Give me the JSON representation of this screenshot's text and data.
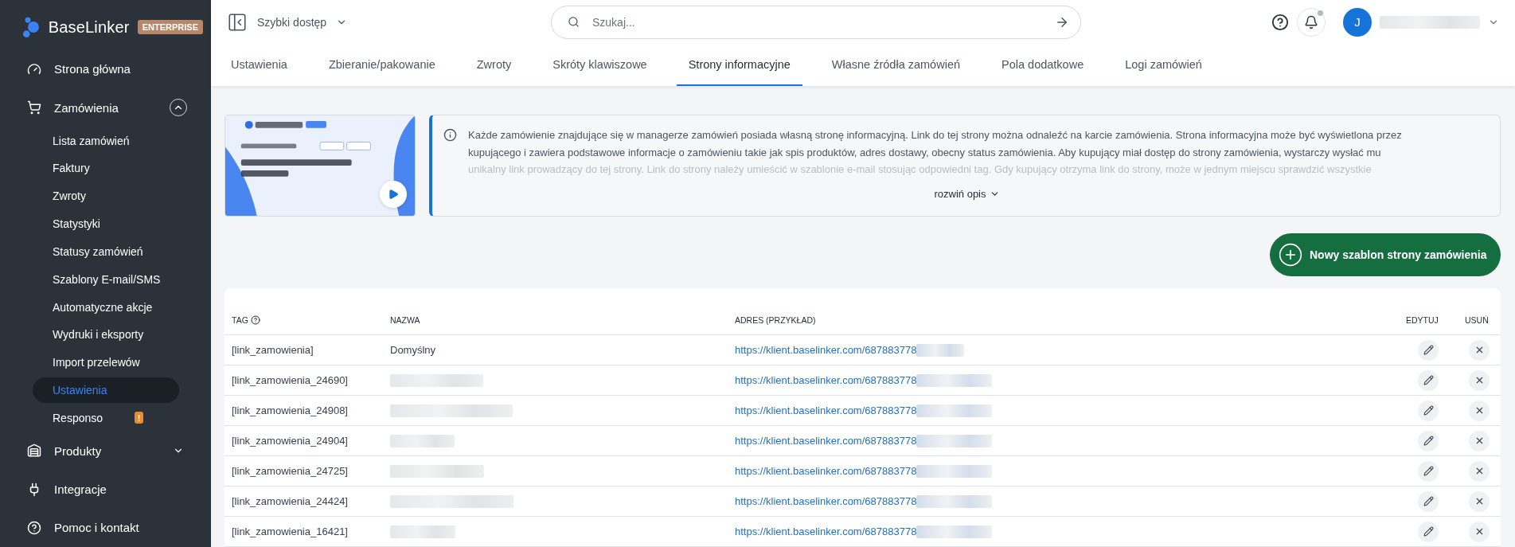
{
  "sidebar": {
    "logo": "BaseLinker",
    "plan_badge": "ENTERPRISE",
    "items": [
      {
        "label": "Strona główna"
      },
      {
        "label": "Zamówienia",
        "expanded": true,
        "children": [
          {
            "label": "Lista zamówień",
            "selected": false
          },
          {
            "label": "Faktury",
            "selected": false
          },
          {
            "label": "Zwroty",
            "selected": false
          },
          {
            "label": "Statystyki",
            "selected": false
          },
          {
            "label": "Statusy zamówień",
            "selected": false
          },
          {
            "label": "Szablony E-mail/SMS",
            "selected": false
          },
          {
            "label": "Automatyczne akcje",
            "selected": false
          },
          {
            "label": "Wydruki i eksporty",
            "selected": false
          },
          {
            "label": "Import przelewów",
            "selected": false
          },
          {
            "label": "Ustawienia",
            "selected": true
          },
          {
            "label": "Responso",
            "selected": false,
            "badge": "!"
          }
        ]
      },
      {
        "label": "Produkty",
        "expanded": false
      },
      {
        "label": "Integracje"
      },
      {
        "label": "Pomoc i kontakt"
      }
    ]
  },
  "topbar": {
    "quick_access": "Szybki dostęp",
    "search": {
      "placeholder": "Szukaj..."
    },
    "notifications": {
      "unread": true
    },
    "user": {
      "initial": "J"
    }
  },
  "tabs": [
    {
      "label": "Ustawienia",
      "selected": false
    },
    {
      "label": "Zbieranie/pakowanie",
      "selected": false
    },
    {
      "label": "Zwroty",
      "selected": false
    },
    {
      "label": "Skróty klawiszowe",
      "selected": false
    },
    {
      "label": "Strony informacyjne",
      "selected": true
    },
    {
      "label": "Własne źródła zamówień",
      "selected": false
    },
    {
      "label": "Pola dodatkowe",
      "selected": false
    },
    {
      "label": "Logi zamówień",
      "selected": false
    }
  ],
  "info": {
    "description_lines": [
      "Każde zamówienie znajdujące się w managerze zamówień posiada własną stronę informacyjną. Link do tej strony można odnaleźć na karcie zamówienia. Strona informacyjna może być wyświetlona przez",
      "kupującego i zawiera podstawowe informacje o zamówieniu takie jak spis produktów, adres dostawy, obecny status zamówienia. Aby kupujący miał dostęp do strony zamówienia, wystarczy wysłać mu",
      "unikalny link prowadzący do tej strony. Link do strony należy umieścić w szablonie e-mail stosując odpowiedni tag. Gdy kupujący otrzyma link do strony, może w jednym miejscu sprawdzić wszystkie"
    ],
    "expand_link": "rozwiń opis"
  },
  "new_button": "Nowy szablon strony zamówienia",
  "table": {
    "columns": [
      "TAG",
      "NAZWA",
      "ADRES (PRZYKŁAD)",
      "EDYTUJ",
      "USUŃ"
    ],
    "rows": [
      {
        "tag": "[link_zamowienia]",
        "name": "Domyślny",
        "address": "https://klient.baselinker.com/687883778"
      },
      {
        "tag": "[link_zamowienia_24690]",
        "address": "https://klient.baselinker.com/687883778"
      },
      {
        "tag": "[link_zamowienia_24908]",
        "address": "https://klient.baselinker.com/687883778"
      },
      {
        "tag": "[link_zamowienia_24904]",
        "address": "https://klient.baselinker.com/687883778"
      },
      {
        "tag": "[link_zamowienia_24725]",
        "address": "https://klient.baselinker.com/687883778"
      },
      {
        "tag": "[link_zamowienia_24424]",
        "address": "https://klient.baselinker.com/687883778"
      },
      {
        "tag": "[link_zamowienia_16421]",
        "address": "https://klient.baselinker.com/687883778"
      }
    ]
  }
}
